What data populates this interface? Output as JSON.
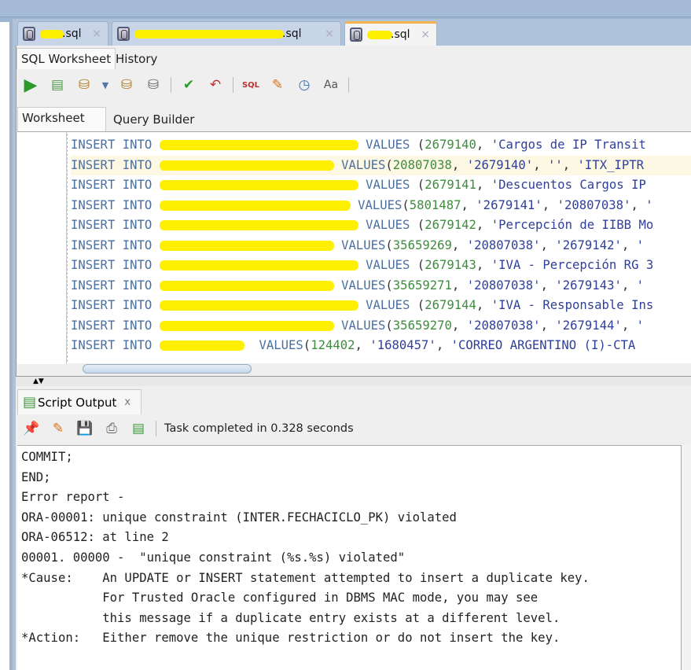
{
  "file_tabs": [
    {
      "label": ".sql",
      "active": false
    },
    {
      "label": ".sql",
      "active": false
    },
    {
      "label": ".sql",
      "active": true
    }
  ],
  "worksheet_tabs": {
    "sql_worksheet": "SQL Worksheet",
    "history": "History"
  },
  "editor_tabs": {
    "worksheet": "Worksheet",
    "query_builder": "Query Builder"
  },
  "toolbar_icons": [
    "run-statement-icon",
    "run-script-icon",
    "autotrace-icon",
    "dropdown-icon",
    "explain-plan-icon",
    "sql-tuning-icon",
    "commit-icon",
    "rollback-icon",
    "unshared-sql-icon",
    "clear-icon",
    "history-icon",
    "format-icon"
  ],
  "code_lines": [
    {
      "kw": "INSERT INTO ",
      "rest": " VALUES (2679140, 'Cargos de IP Transit"
    },
    {
      "kw": "INSERT INTO ",
      "rest": " VALUES(20807038, '2679140', '', 'ITX_IPTR"
    },
    {
      "kw": "INSERT INTO ",
      "rest": " VALUES (2679141, 'Descuentos Cargos IP"
    },
    {
      "kw": "INSERT INTO ",
      "rest": " VALUES(5801487, '2679141', '20807038', '"
    },
    {
      "kw": "INSERT INTO ",
      "rest": " VALUES (2679142, 'Percepción de IIBB Mo"
    },
    {
      "kw": "INSERT INTO ",
      "rest": " VALUES(35659269, '20807038', '2679142', '"
    },
    {
      "kw": "INSERT INTO ",
      "rest": " VALUES (2679143, 'IVA - Percepción RG 3"
    },
    {
      "kw": "INSERT INTO ",
      "rest": " VALUES(35659271, '20807038', '2679143', '"
    },
    {
      "kw": "INSERT INTO ",
      "rest": " VALUES (2679144, 'IVA - Responsable Ins"
    },
    {
      "kw": "INSERT INTO ",
      "rest": " VALUES(35659270, '20807038', '2679144', '"
    },
    {
      "kw": "INSERT INTO ",
      "rest": "  VALUES(124402, '1680457', 'CORREO ARGENTINO (I)-CTA"
    }
  ],
  "output_panel": {
    "tab_label": "Script Output",
    "close": "x",
    "status": "Task completed in 0.328 seconds",
    "toolbar_icons": [
      "pin-icon",
      "clear-icon",
      "save-icon",
      "print-icon",
      "run-script-icon"
    ]
  },
  "output_lines": [
    "COMMIT;",
    "END;",
    "Error report -",
    "ORA-00001: unique constraint (INTER.FECHACICLO_PK) violated",
    "ORA-06512: at line 2",
    "00001. 00000 -  \"unique constraint (%s.%s) violated\"",
    "*Cause:    An UPDATE or INSERT statement attempted to insert a duplicate key.",
    "           For Trusted Oracle configured in DBMS MAC mode, you may see",
    "           this message if a duplicate entry exists at a different level.",
    "*Action:   Either remove the unique restriction or do not insert the key."
  ]
}
